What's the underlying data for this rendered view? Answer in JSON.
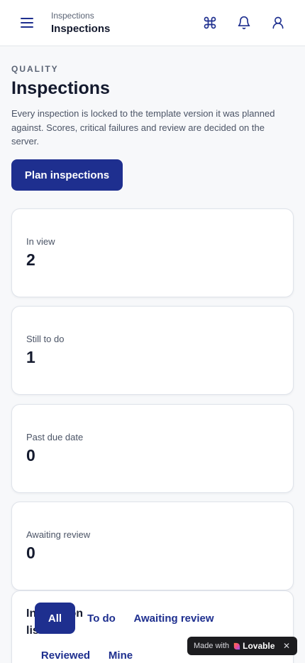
{
  "topbar": {
    "breadcrumb": "Inspections",
    "title": "Inspections",
    "icons": [
      "menu-icon",
      "command-icon",
      "bell-icon",
      "user-icon"
    ]
  },
  "header": {
    "eyebrow": "QUALITY",
    "title": "Inspections",
    "description": "Every inspection is locked to the template version it was planned against. Scores, critical failures and review are decided on the server.",
    "plan_button": "Plan inspections"
  },
  "stats": [
    {
      "label": "In view",
      "value": "2"
    },
    {
      "label": "Still to do",
      "value": "1"
    },
    {
      "label": "Past due date",
      "value": "0"
    },
    {
      "label": "Awaiting review",
      "value": "0"
    }
  ],
  "list": {
    "title": "Inspection list",
    "tabs": [
      {
        "label": "All",
        "active": true
      },
      {
        "label": "To do",
        "active": false
      },
      {
        "label": "Awaiting review",
        "active": false
      },
      {
        "label": "Reviewed",
        "active": false
      },
      {
        "label": "Mine",
        "active": false
      }
    ]
  },
  "badge": {
    "prefix": "Made with",
    "brand": "Lovable",
    "close": "✕"
  },
  "colors": {
    "primary": "#1e2f8f",
    "background": "#f7f8fa",
    "text": "#141a2e",
    "muted": "#4b5466"
  }
}
